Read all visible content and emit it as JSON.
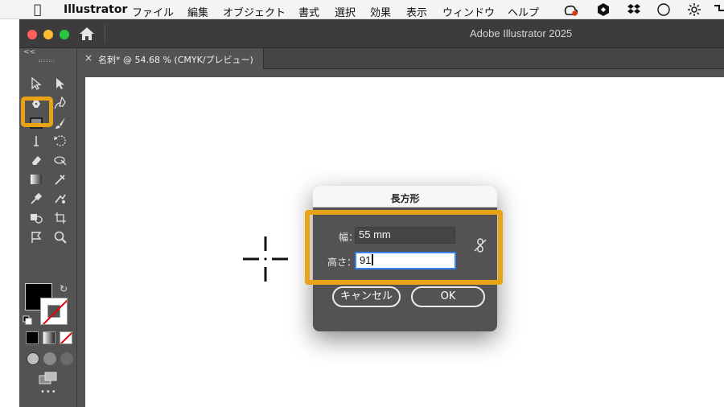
{
  "menubar": {
    "app_name": "Illustrator",
    "items": [
      "ファイル",
      "編集",
      "オブジェクト",
      "書式",
      "選択",
      "効果",
      "表示",
      "ウィンドウ",
      "ヘルプ"
    ]
  },
  "window": {
    "title": "Adobe Illustrator 2025"
  },
  "tab": {
    "close_glyph": "×",
    "label": "名刺* @ 54.68 % (CMYK/プレビュー)"
  },
  "dialog": {
    "title": "長方形",
    "width_label": "幅：",
    "width_value": "55 mm",
    "height_label": "高さ：",
    "height_value": "91",
    "cancel_label": "キャンセル",
    "ok_label": "OK"
  },
  "toolbar": {
    "more_glyph": "•••"
  },
  "colors": {
    "highlight": "#e8a317",
    "panel": "#535353",
    "focus_ring": "#3a82f7"
  },
  "icons": [
    "apple-icon",
    "creative-cloud-icon",
    "dropbox-icon",
    "home-icon",
    "selection-tool-icon",
    "direct-selection-tool-icon",
    "pen-tool-icon",
    "curvature-tool-icon",
    "rectangle-tool-icon",
    "paintbrush-tool-icon",
    "type-tool-icon",
    "rotate-tool-icon",
    "eraser-tool-icon",
    "width-tool-icon",
    "gradient-tool-icon",
    "eyedropper-tool-icon",
    "zoom-tool-icon",
    "constrain-proportions-icon",
    "crosshair-cursor-icon"
  ]
}
